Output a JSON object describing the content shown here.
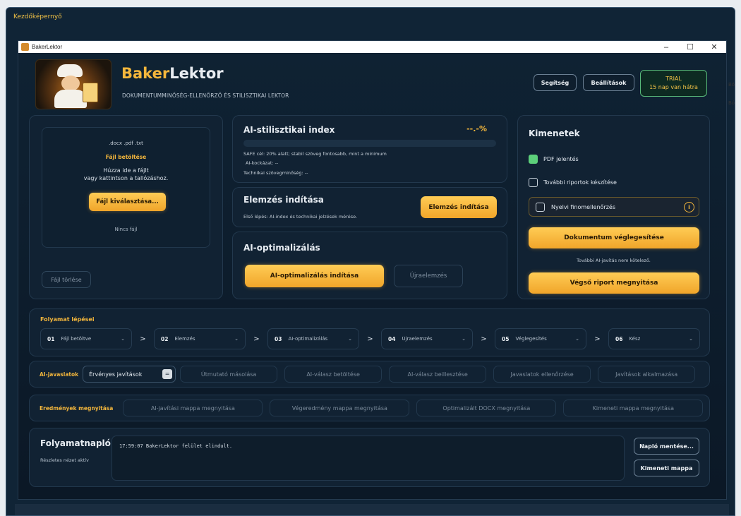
{
  "desktop": {
    "title": "Kezdőképernyő"
  },
  "window": {
    "title": "BakerLektor",
    "controls": [
      "–",
      "☐",
      "✕"
    ]
  },
  "header": {
    "brand_part1": "Baker",
    "brand_part2": "Lektor",
    "subtitle": "DOKUMENTUMMINŐSÉG-ELLENŐRZŐ ÉS STILISZTIKAI LEKTOR",
    "help_label": "Segítség",
    "settings_label": "Beállítások",
    "trial_title": "TRIAL",
    "trial_days": "15 nap van hátra"
  },
  "upload": {
    "extensions": ".docx   .pdf   .txt",
    "heading": "Fájl betöltése",
    "hint_line1": "Húzza ide a fájlt",
    "hint_line2": "vagy kattintson a tallózáshoz.",
    "pick_label": "Fájl kiválasztása...",
    "no_file": "Nincs fájl",
    "delete_label": "Fájl törlése"
  },
  "ai_index": {
    "title": "AI-stilisztikai index",
    "percent": "--.-%",
    "line1": "SAFE cél: 20% alatt; stabil szöveg fontosabb, mint a minimum",
    "line2": "AI-kockázat: --",
    "line3": "Technikai szövegminőség: --"
  },
  "analysis": {
    "title": "Elemzés indítása",
    "subtitle": "Első lépés: AI-index és technikai jelzések mérése.",
    "button": "Elemzés indítása"
  },
  "optimize": {
    "title": "AI-optimalizálás",
    "button": "AI-optimalizálás indítása",
    "reanalyze": "Újraelemzés"
  },
  "outputs": {
    "title": "Kimenetek",
    "pdf_label": "PDF jelentés",
    "more_label": "További riportok készítése",
    "lang_label": "Nyelvi finomellenőrzés",
    "info_icon": "i",
    "finalize": "Dokumentum véglegesítése",
    "note": "További AI-javítás nem kötelező.",
    "report": "Végső riport megnyitása"
  },
  "steps": {
    "title": "Folyamat lépései",
    "items": [
      {
        "num": "01",
        "label": "Fájl betöltve"
      },
      {
        "num": "02",
        "label": "Elemzés"
      },
      {
        "num": "03",
        "label": "AI-optimalizálás"
      },
      {
        "num": "04",
        "label": "Újraelemzés"
      },
      {
        "num": "05",
        "label": "Véglegesítés"
      },
      {
        "num": "06",
        "label": "Kész"
      }
    ],
    "dropdown": "⌄",
    "separator": ">"
  },
  "suggestions": {
    "title": "AI-javaslatok",
    "select_value": "Érvényes javítások",
    "select_key": "=",
    "buttons": [
      "Útmutató másolása",
      "AI-válasz betöltése",
      "AI-válasz beillesztése",
      "Javaslatok ellenőrzése",
      "Javítások alkalmazása"
    ]
  },
  "results": {
    "title": "Eredmények megnyitása",
    "buttons": [
      "AI-javítási mappa megnyitása",
      "Végeredmény mappa megnyitása",
      "Optimalizált DOCX megnyitása",
      "Kimeneti mappa megnyitása"
    ]
  },
  "log": {
    "title": "Folyamatnapló",
    "subtitle": "Részletes nézet aktív",
    "entry": "17:59:07  BakerLektor felület elindult.",
    "save_label": "Napló mentése...",
    "output_label": "Kimeneti mappa"
  },
  "edge": {
    "text1": "Bó",
    "text2": "Bó"
  }
}
